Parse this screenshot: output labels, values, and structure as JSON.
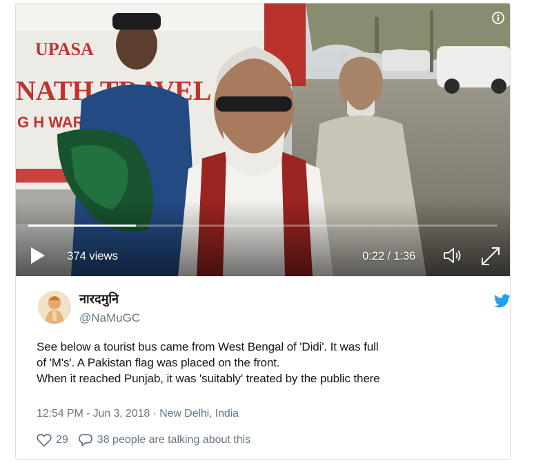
{
  "video": {
    "views": "374 views",
    "time": "0:22 / 1:36",
    "progress": 0.23,
    "scene_text": {
      "bus_top": "UPASA",
      "bus_mid": "NATH TRAVEL",
      "bus_low": "G H WAR"
    }
  },
  "tweet": {
    "display_name": "नारदमुनि",
    "handle": "@NaMuGC",
    "text_lines": [
      "See below a tourist bus came from West Bengal of 'Didi'. It was full",
      "of 'M's'. A Pakistan flag was placed on the front.",
      "When it reached Punjab, it was 'suitably' treated by the public there"
    ],
    "timestamp": "12:54 PM - Jun 3, 2018",
    "separator": " · ",
    "location": "New Delhi, India",
    "likes": "29",
    "talking": "38 people are talking about this"
  },
  "colors": {
    "twitter_blue": "#1da1f2",
    "text_primary": "#14171a",
    "text_secondary": "#657786",
    "border": "#d9dfe3"
  },
  "icons": [
    "play-icon",
    "volume-icon",
    "fullscreen-icon",
    "info-icon",
    "twitter-bird-icon",
    "heart-icon",
    "comment-icon"
  ]
}
